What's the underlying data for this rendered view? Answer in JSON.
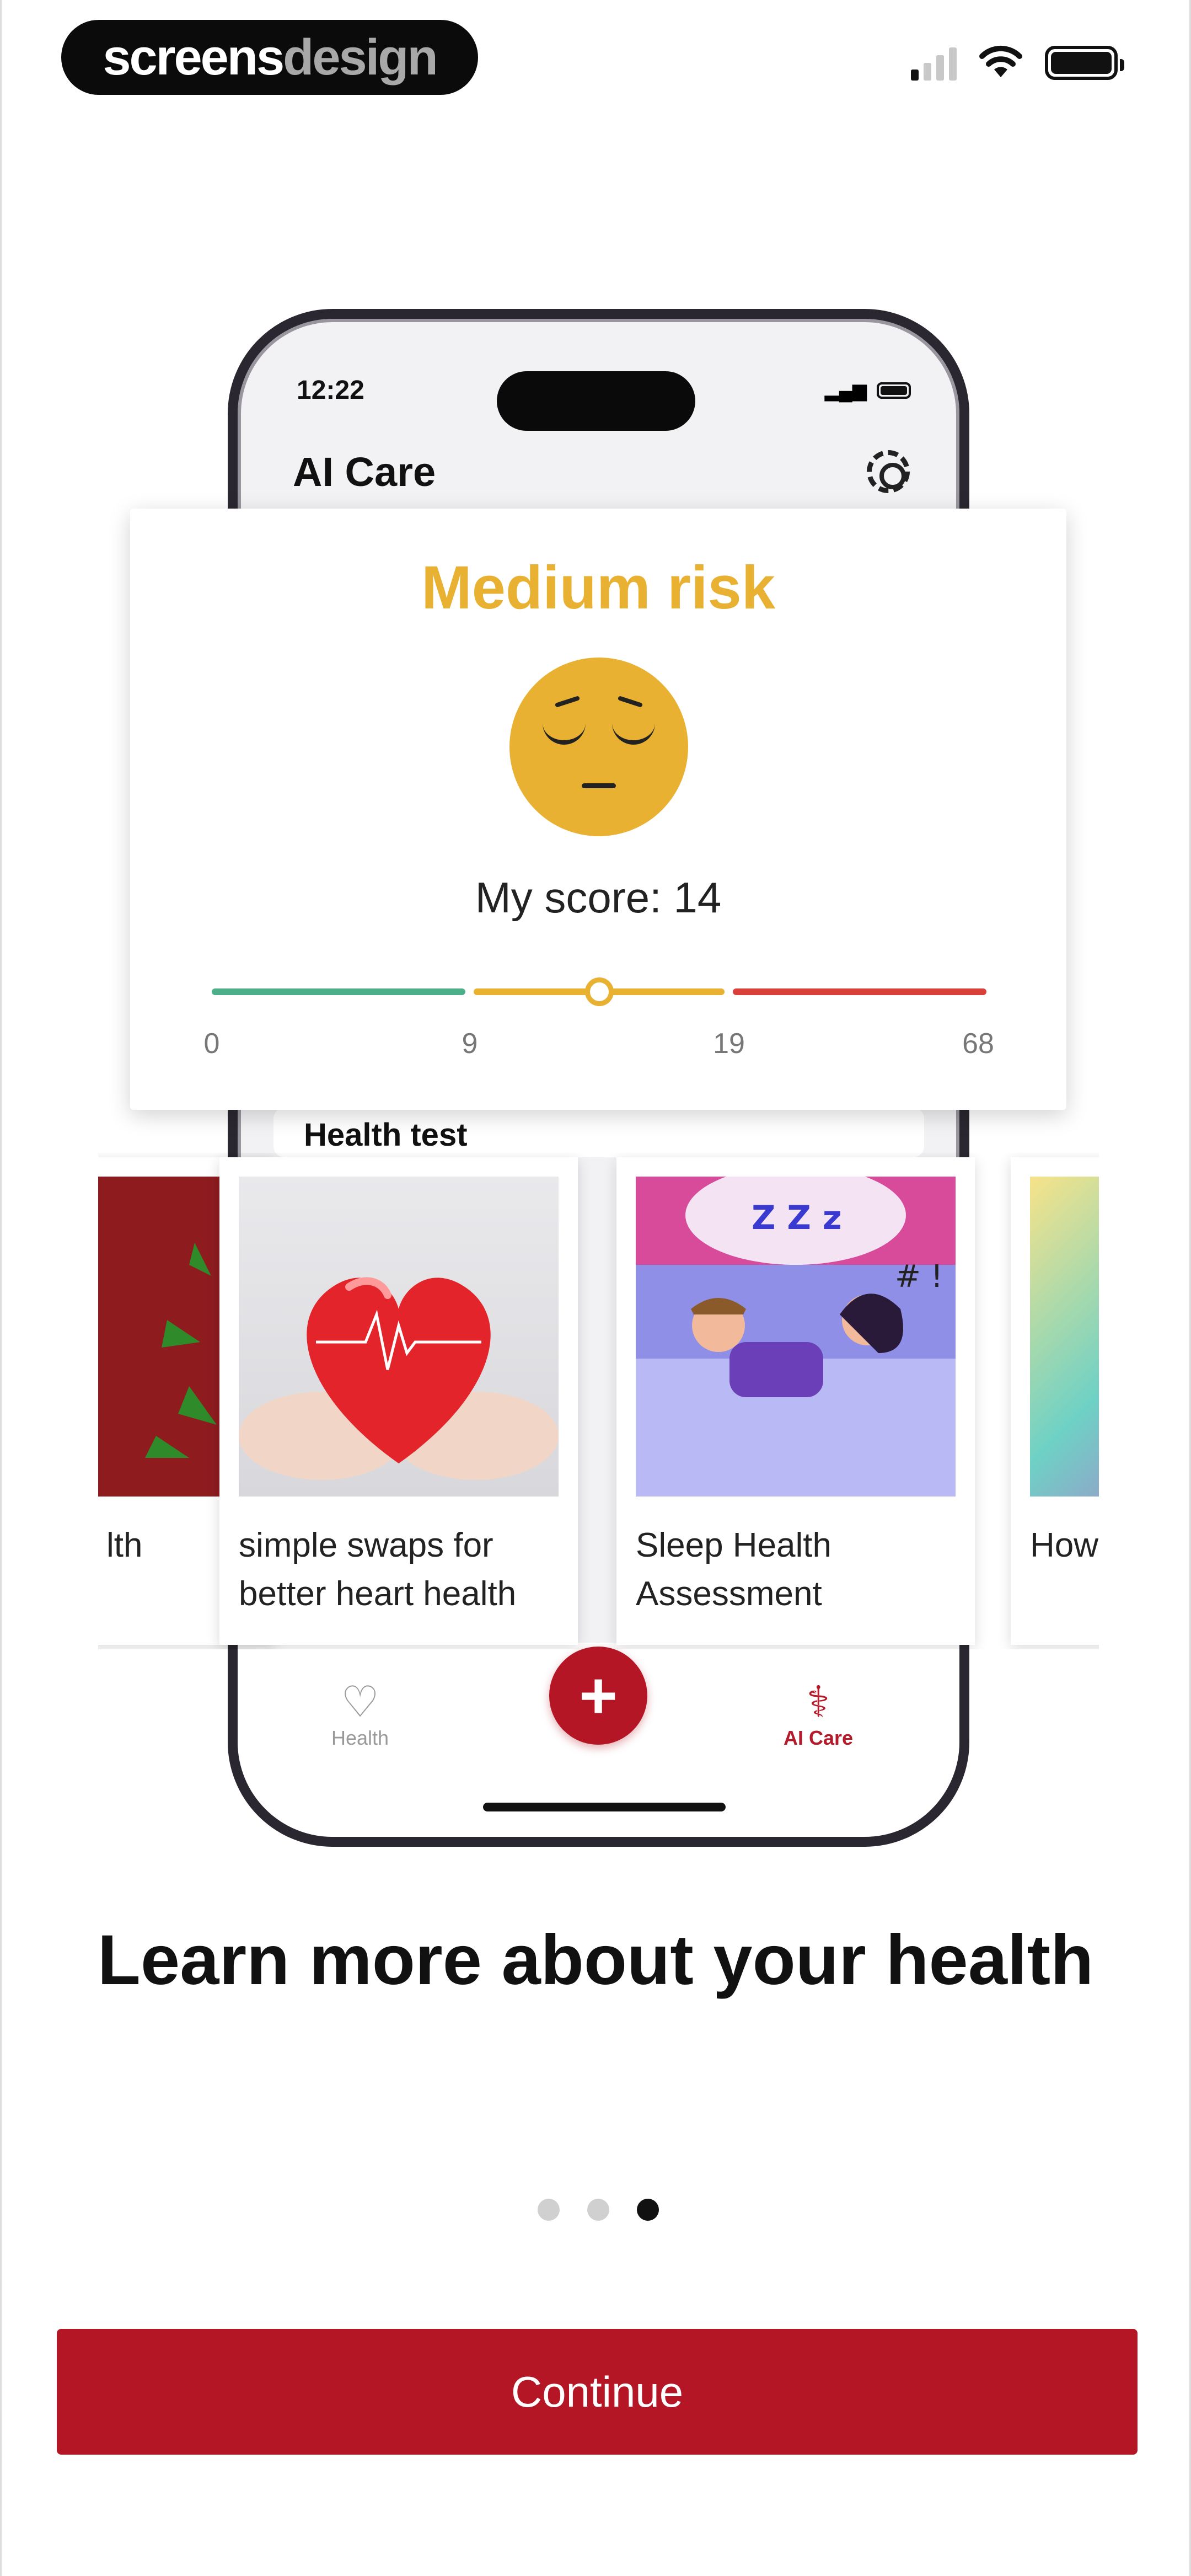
{
  "brand": {
    "part1": "screens",
    "part2": "design"
  },
  "phone": {
    "time": "12:22",
    "title": "AI Care",
    "section_title": "Health test",
    "tabs": [
      {
        "label": "Health",
        "icon": "heart-plus-icon",
        "active": false
      },
      {
        "label": "AI Care",
        "icon": "stethoscope-icon",
        "active": true
      }
    ],
    "fab_label": "+"
  },
  "risk_card": {
    "title": "Medium risk",
    "score_text": "My score: 14",
    "score": 14,
    "ticks": [
      "0",
      "9",
      "19",
      "68"
    ],
    "colors": {
      "low": "#4daf8a",
      "medium": "#e8b131",
      "high": "#d9403a"
    }
  },
  "articles": [
    {
      "caption": "lth",
      "image": "cannabis-leaves-image"
    },
    {
      "caption": "simple swaps for better heart health",
      "image": "heart-in-hands-image"
    },
    {
      "caption": "Sleep Health Assessment",
      "image": "couple-sleeping-snoring-image"
    },
    {
      "caption": "How Been",
      "image": "colorful-head-profile-image"
    }
  ],
  "onboarding": {
    "headline": "Learn more about your health",
    "page_count": 3,
    "active_page": 3,
    "continue_label": "Continue"
  },
  "colors": {
    "accent": "#b51625",
    "warning": "#e8b131"
  }
}
